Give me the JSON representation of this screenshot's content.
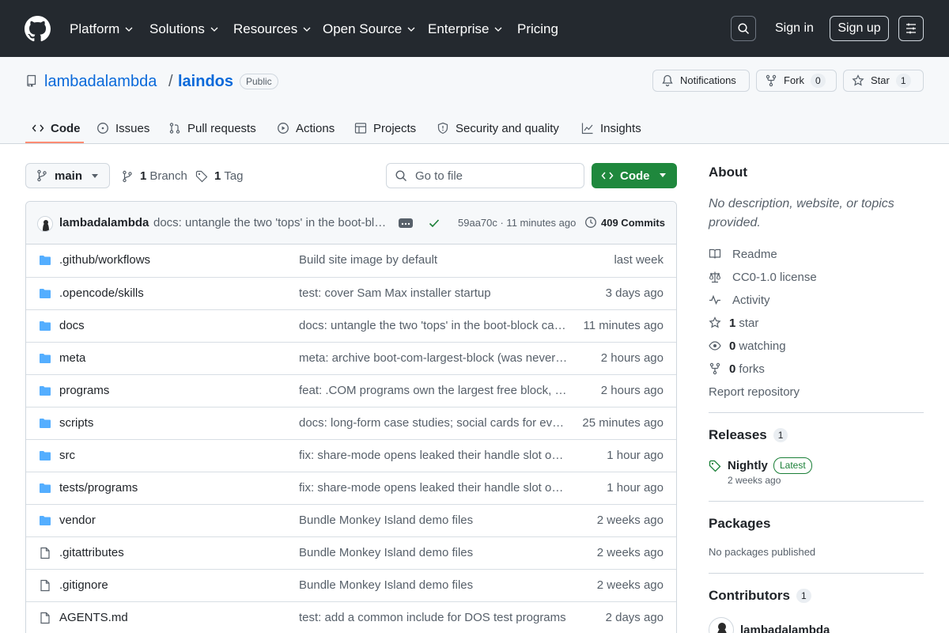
{
  "nav": {
    "items": [
      {
        "label": "Platform",
        "dropdown": true
      },
      {
        "label": "Solutions",
        "dropdown": true
      },
      {
        "label": "Resources",
        "dropdown": true
      },
      {
        "label": "Open Source",
        "dropdown": true
      },
      {
        "label": "Enterprise",
        "dropdown": true
      },
      {
        "label": "Pricing",
        "dropdown": false
      }
    ],
    "sign_in": "Sign in",
    "sign_up": "Sign up"
  },
  "repo": {
    "owner": "lambadalambda",
    "separator": "/",
    "name": "laindos",
    "visibility": "Public",
    "notifications_label": "Notifications",
    "fork_label": "Fork",
    "fork_count": "0",
    "star_label": "Star",
    "star_count": "1"
  },
  "tabs": [
    {
      "label": "Code",
      "icon": "code-icon",
      "active": true
    },
    {
      "label": "Issues",
      "icon": "issue-icon",
      "active": false
    },
    {
      "label": "Pull requests",
      "icon": "pull-request-icon",
      "active": false
    },
    {
      "label": "Actions",
      "icon": "play-icon",
      "active": false
    },
    {
      "label": "Projects",
      "icon": "table-icon",
      "active": false
    },
    {
      "label": "Security and quality",
      "icon": "shield-icon",
      "active": false
    },
    {
      "label": "Insights",
      "icon": "graph-icon",
      "active": false
    }
  ],
  "branch_bar": {
    "branch": "main",
    "branch_count": "1",
    "branch_label": "Branch",
    "tag_count": "1",
    "tag_label": "Tag",
    "goto_placeholder": "Go to file",
    "code_button": "Code"
  },
  "latest_commit": {
    "author": "lambadalambda",
    "message": "docs: untangle the two 'tops' in the boot-block ca...",
    "hash_time": "59aa70c · 11 minutes ago",
    "commits_count": "409 Commits"
  },
  "files": [
    {
      "type": "folder",
      "name": ".github/workflows",
      "message": "Build site image by default",
      "time": "last week"
    },
    {
      "type": "folder",
      "name": ".opencode/skills",
      "message": "test: cover Sam Max installer startup",
      "time": "3 days ago"
    },
    {
      "type": "folder",
      "name": "docs",
      "message": "docs: untangle the two 'tops' in the boot-block cas...",
      "time": "11 minutes ago"
    },
    {
      "type": "folder",
      "name": "meta",
      "message": "meta: archive boot-com-largest-block (was never i...",
      "time": "2 hours ago"
    },
    {
      "type": "folder",
      "name": "programs",
      "message": "feat: .COM programs own the largest free block, li...",
      "time": "2 hours ago"
    },
    {
      "type": "folder",
      "name": "scripts",
      "message": "docs: long-form case studies; social cards for ever...",
      "time": "25 minutes ago"
    },
    {
      "type": "folder",
      "name": "src",
      "message": "fix: share-mode opens leaked their handle slot on ...",
      "time": "1 hour ago"
    },
    {
      "type": "folder",
      "name": "tests/programs",
      "message": "fix: share-mode opens leaked their handle slot on ...",
      "time": "1 hour ago"
    },
    {
      "type": "folder",
      "name": "vendor",
      "message": "Bundle Monkey Island demo files",
      "time": "2 weeks ago"
    },
    {
      "type": "file",
      "name": ".gitattributes",
      "message": "Bundle Monkey Island demo files",
      "time": "2 weeks ago"
    },
    {
      "type": "file",
      "name": ".gitignore",
      "message": "Bundle Monkey Island demo files",
      "time": "2 weeks ago"
    },
    {
      "type": "file",
      "name": "AGENTS.md",
      "message": "test: add a common include for DOS test programs",
      "time": "2 days ago"
    }
  ],
  "about": {
    "heading": "About",
    "description": "No description, website, or topics provided.",
    "links": [
      {
        "icon": "book-icon",
        "count": "",
        "label": "Readme"
      },
      {
        "icon": "law-icon",
        "count": "",
        "label": "CC0-1.0 license"
      },
      {
        "icon": "pulse-icon",
        "count": "",
        "label": "Activity"
      },
      {
        "icon": "star-icon",
        "count": "1",
        "label": "star"
      },
      {
        "icon": "eye-icon",
        "count": "0",
        "label": "watching"
      },
      {
        "icon": "fork-icon",
        "count": "0",
        "label": "forks"
      },
      {
        "icon": "",
        "count": "",
        "label": "Report repository"
      }
    ]
  },
  "releases": {
    "heading": "Releases",
    "count": "1",
    "name": "Nightly",
    "badge": "Latest",
    "date": "2 weeks ago"
  },
  "packages": {
    "heading": "Packages",
    "empty_text": "No packages published"
  },
  "contributors": {
    "heading": "Contributors",
    "count": "1",
    "name": "lambadalambda"
  },
  "colors": {
    "nav_bg": "#24292f",
    "link": "#0969da",
    "accent_green": "#1f883d",
    "folder": "#54aeff",
    "tab_underline": "#fd8c73"
  }
}
